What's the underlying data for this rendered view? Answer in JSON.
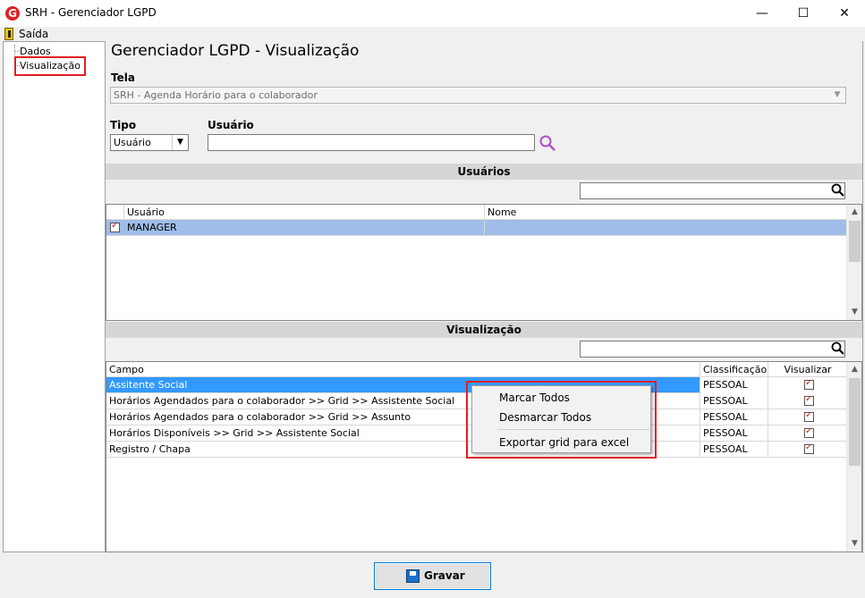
{
  "window": {
    "title": "SRH - Gerenciador LGPD",
    "app_icon_glyph": "G",
    "minimize_glyph": "—",
    "maximize_glyph": "☐",
    "close_glyph": "✕"
  },
  "menu": {
    "exit_label": "Saída"
  },
  "tree": {
    "items": [
      {
        "label": "Dados"
      },
      {
        "label": "Visualização",
        "selected": true
      }
    ]
  },
  "main": {
    "title": "Gerenciador LGPD - Visualização",
    "tela": {
      "label": "Tela",
      "value": "SRH - Agenda Horário para o colaborador"
    },
    "tipo": {
      "label": "Tipo",
      "value": "Usuário"
    },
    "usuario": {
      "label": "Usuário",
      "value": ""
    },
    "usuarios_section": {
      "header": "Usuários",
      "filter_value": "",
      "columns": [
        "Usuário",
        "Nome"
      ],
      "rows": [
        {
          "checked": true,
          "usuario": "MANAGER",
          "nome": ""
        }
      ]
    },
    "visualizacao_section": {
      "header": "Visualização",
      "filter_value": "",
      "columns": [
        "Campo",
        "Classificação",
        "Visualizar"
      ],
      "rows": [
        {
          "campo": "Assitente Social",
          "classificacao": "PESSOAL",
          "visualizar": true,
          "selected": true
        },
        {
          "campo": "Horários Agendados para o colaborador >> Grid >> Assistente Social",
          "classificacao": "PESSOAL",
          "visualizar": true
        },
        {
          "campo": "Horários Agendados para o colaborador >> Grid >> Assunto",
          "classificacao": "PESSOAL",
          "visualizar": true
        },
        {
          "campo": "Horários Disponíveis >> Grid >> Assistente Social",
          "classificacao": "PESSOAL",
          "visualizar": true
        },
        {
          "campo": "Registro / Chapa",
          "classificacao": "PESSOAL",
          "visualizar": true
        }
      ]
    }
  },
  "context_menu": {
    "items": [
      "Marcar Todos",
      "Desmarcar Todos",
      "Exportar grid para excel"
    ]
  },
  "footer": {
    "save_label": "Gravar"
  },
  "colors": {
    "selection": "#3399ff",
    "highlight_border": "#e02020",
    "check_red": "#e01010",
    "search_icon_purple": "#b04fc8"
  },
  "icons": [
    "app-logo-icon",
    "exit-door-icon",
    "search-icon",
    "magnifier-icon",
    "save-disk-icon",
    "dropdown-arrow-icon",
    "scroll-up-icon",
    "scroll-down-icon"
  ]
}
